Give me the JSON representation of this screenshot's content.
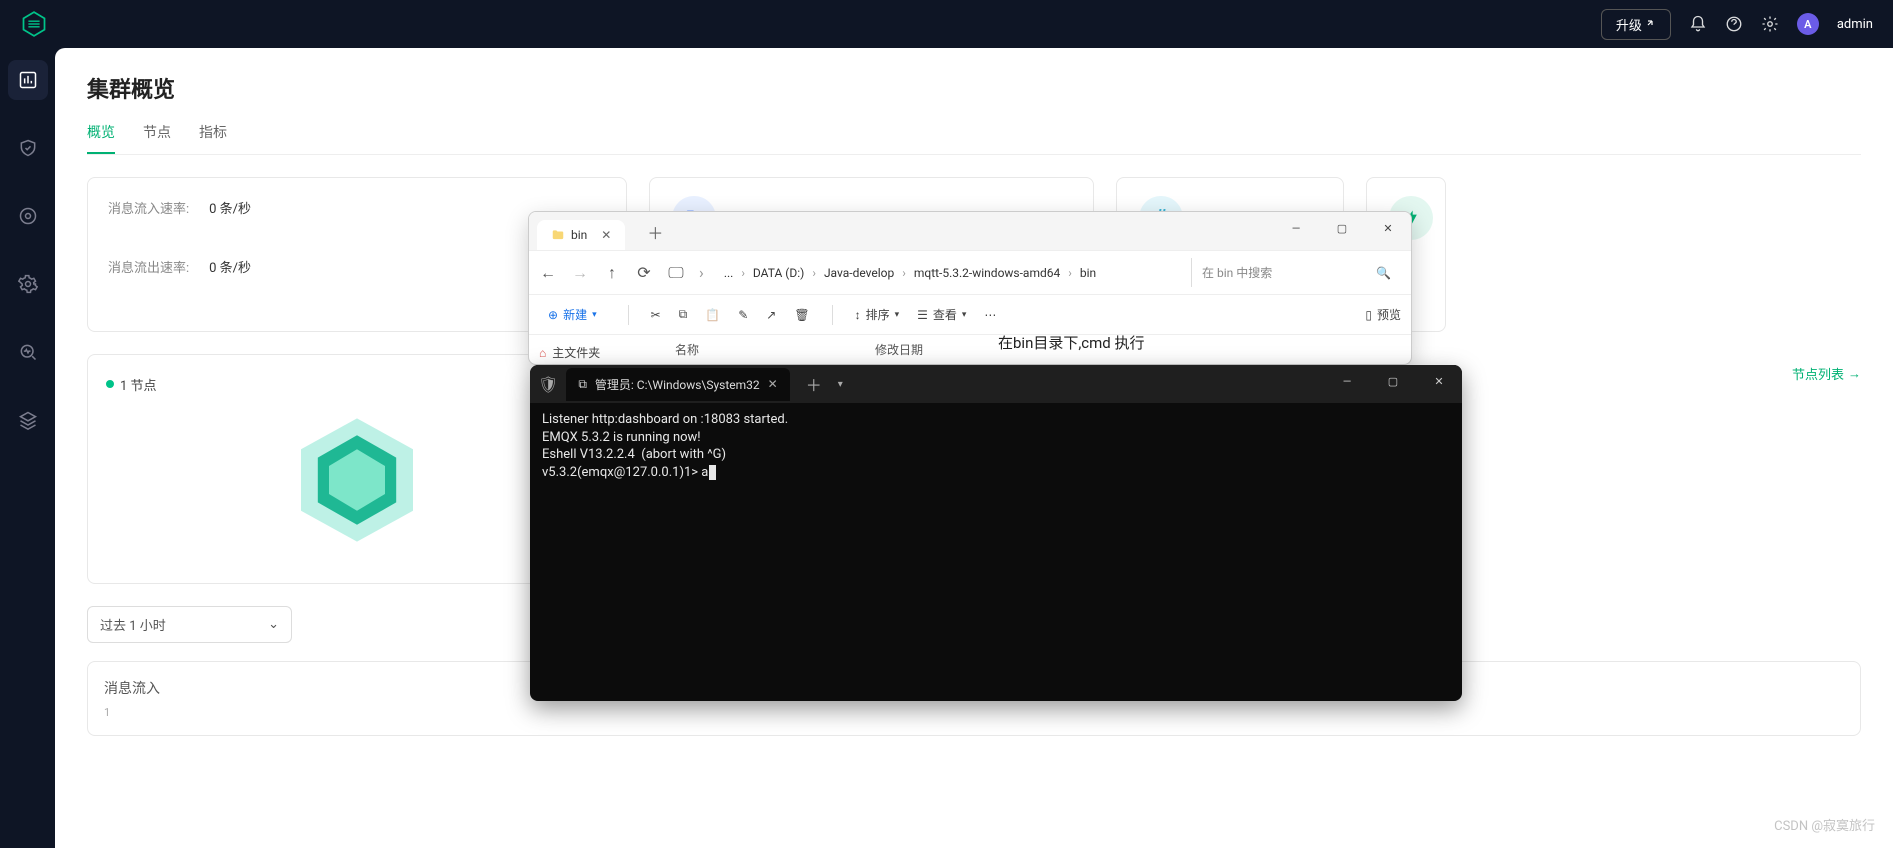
{
  "topbar": {
    "upgrade_label": "升级",
    "admin_initial": "A",
    "admin_name": "admin"
  },
  "page": {
    "title": "集群概览",
    "tabs": [
      "概览",
      "节点",
      "指标"
    ]
  },
  "rates": {
    "in_label": "消息流入速率:",
    "in_value": "0 条/秒",
    "out_label": "消息流出速率:",
    "out_value": "0 条/秒"
  },
  "node": {
    "badge": "1 节点",
    "view_list": "节点列表"
  },
  "time_select": "过去 1 小时",
  "chart": {
    "title": "消息流入",
    "axis0": "1"
  },
  "explorer": {
    "tab_title": "bin",
    "breadcrumb": [
      "...",
      "DATA (D:)",
      "Java-develop",
      "mqtt-5.3.2-windows-amd64",
      "bin"
    ],
    "search_placeholder": "在 bin 中搜索",
    "toolbar": {
      "new_label": "新建",
      "sort_label": "排序",
      "view_label": "查看",
      "preview_label": "预览"
    },
    "home_folder": "主文件夹",
    "cols": {
      "name": "名称",
      "date": "修改日期"
    }
  },
  "annotation": {
    "line1": "在bin目录下,cmd 执行"
  },
  "terminal": {
    "tab_title": "管理员: C:\\Windows\\System32",
    "lines": [
      "Listener http:dashboard on :18083 started.",
      "EMQX 5.3.2 is running now!",
      "Eshell V13.2.2.4  (abort with ^G)",
      "v5.3.2(emqx@127.0.0.1)1> a"
    ]
  },
  "watermark": "CSDN @寂寞旅行"
}
